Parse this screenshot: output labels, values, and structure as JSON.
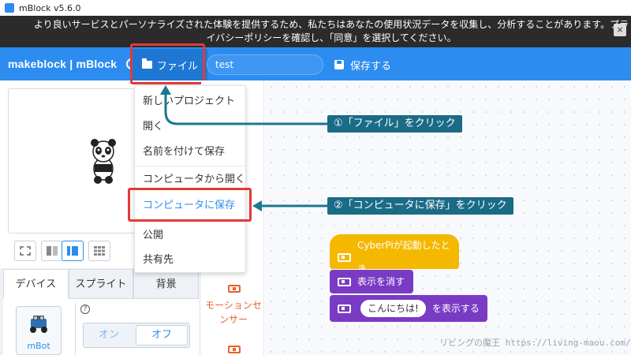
{
  "window": {
    "title": "mBlock v5.6.0"
  },
  "notice": {
    "line1": "より良いサービスとパーソナライズされた体験を提供するため、私たちはあなたの使用状況データを収集し、分析することがあります。プラ",
    "line2": "イバシーポリシーを確認し、「同意」を選択してください。",
    "close": "×"
  },
  "menubar": {
    "logo": "makeblock | mBlock",
    "file_label": "ファイル",
    "project_name": "test",
    "save_label": "保存する"
  },
  "file_menu": {
    "items": [
      "新しいプロジェクト",
      "開く",
      "名前を付けて保存",
      "コンピュータから開く",
      "コンピュータに保存",
      "公開",
      "共有先"
    ]
  },
  "annotations": {
    "step1": "①「ファイル」をクリック",
    "step2": "②「コンピュータに保存」をクリック"
  },
  "tabs": [
    "デバイス",
    "スプライト",
    "背景"
  ],
  "device": {
    "name": "mBot",
    "help": "?"
  },
  "toggle": {
    "on": "オン",
    "off": "オフ"
  },
  "category": {
    "label": "モーションセンサー"
  },
  "blocks": {
    "hat": "CyberPiが起動したとき",
    "clear": "表示を消す",
    "show_value": "こんにちは!",
    "show_suffix": "を表示する"
  },
  "watermark": "リビングの魔王 https://living-maou.com/",
  "colors": {
    "menubar": "#2d8cf0",
    "highlight": "#e53935",
    "callout": "#1a6b86",
    "hat_block": "#f5b800",
    "looks_block": "#7a3bc4",
    "category": "#e8622a"
  }
}
